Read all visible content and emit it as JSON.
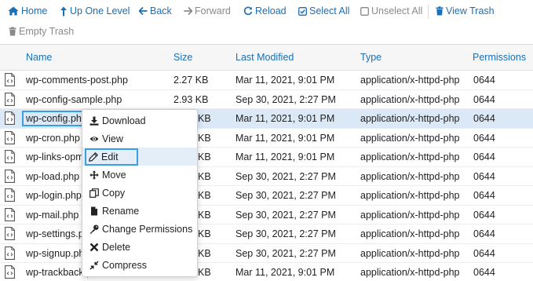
{
  "toolbar": {
    "home": "Home",
    "up": "Up One Level",
    "back": "Back",
    "forward": "Forward",
    "reload": "Reload",
    "select_all": "Select All",
    "unselect_all": "Unselect All",
    "view_trash": "View Trash",
    "empty_trash": "Empty Trash"
  },
  "table": {
    "headers": {
      "name": "Name",
      "size": "Size",
      "modified": "Last Modified",
      "type": "Type",
      "perms": "Permissions"
    },
    "rows": [
      {
        "name": "wp-comments-post.php",
        "size": "2.27 KB",
        "modified": "Mar 11, 2021, 9:01 PM",
        "type": "application/x-httpd-php",
        "perms": "0644"
      },
      {
        "name": "wp-config-sample.php",
        "size": "2.93 KB",
        "modified": "Sep 30, 2021, 2:27 PM",
        "type": "application/x-httpd-php",
        "perms": "0644"
      },
      {
        "name": "wp-config.php",
        "size": "KB",
        "modified": "Mar 11, 2021, 9:01 PM",
        "type": "application/x-httpd-php",
        "perms": "0644"
      },
      {
        "name": "wp-cron.php",
        "size": "KB",
        "modified": "Mar 11, 2021, 9:01 PM",
        "type": "application/x-httpd-php",
        "perms": "0644"
      },
      {
        "name": "wp-links-opml.",
        "size": "KB",
        "modified": "Mar 11, 2021, 9:01 PM",
        "type": "application/x-httpd-php",
        "perms": "0644"
      },
      {
        "name": "wp-load.php",
        "size": "KB",
        "modified": "Sep 30, 2021, 2:27 PM",
        "type": "application/x-httpd-php",
        "perms": "0644"
      },
      {
        "name": "wp-login.php",
        "size": "KB",
        "modified": "Sep 30, 2021, 2:27 PM",
        "type": "application/x-httpd-php",
        "perms": "0644"
      },
      {
        "name": "wp-mail.php",
        "size": "KB",
        "modified": "Sep 30, 2021, 2:27 PM",
        "type": "application/x-httpd-php",
        "perms": "0644"
      },
      {
        "name": "wp-settings.ph",
        "size": "KB",
        "modified": "Sep 30, 2021, 2:27 PM",
        "type": "application/x-httpd-php",
        "perms": "0644"
      },
      {
        "name": "wp-signup.php",
        "size": "KB",
        "modified": "Sep 30, 2021, 2:27 PM",
        "type": "application/x-httpd-php",
        "perms": "0644"
      },
      {
        "name": "wp-trackback.p",
        "size": "KB",
        "modified": "Mar 11, 2021, 9:01 PM",
        "type": "application/x-httpd-php",
        "perms": "0644"
      }
    ]
  },
  "context_menu": {
    "download": "Download",
    "view": "View",
    "edit": "Edit",
    "move": "Move",
    "copy": "Copy",
    "rename": "Rename",
    "change_permissions": "Change Permissions",
    "delete": "Delete",
    "compress": "Compress"
  },
  "colors": {
    "link": "#1a6fb5",
    "disabled": "#8a8a8a",
    "selected_row": "#dbe9f7",
    "highlight_outline": "#3a9ee0"
  }
}
